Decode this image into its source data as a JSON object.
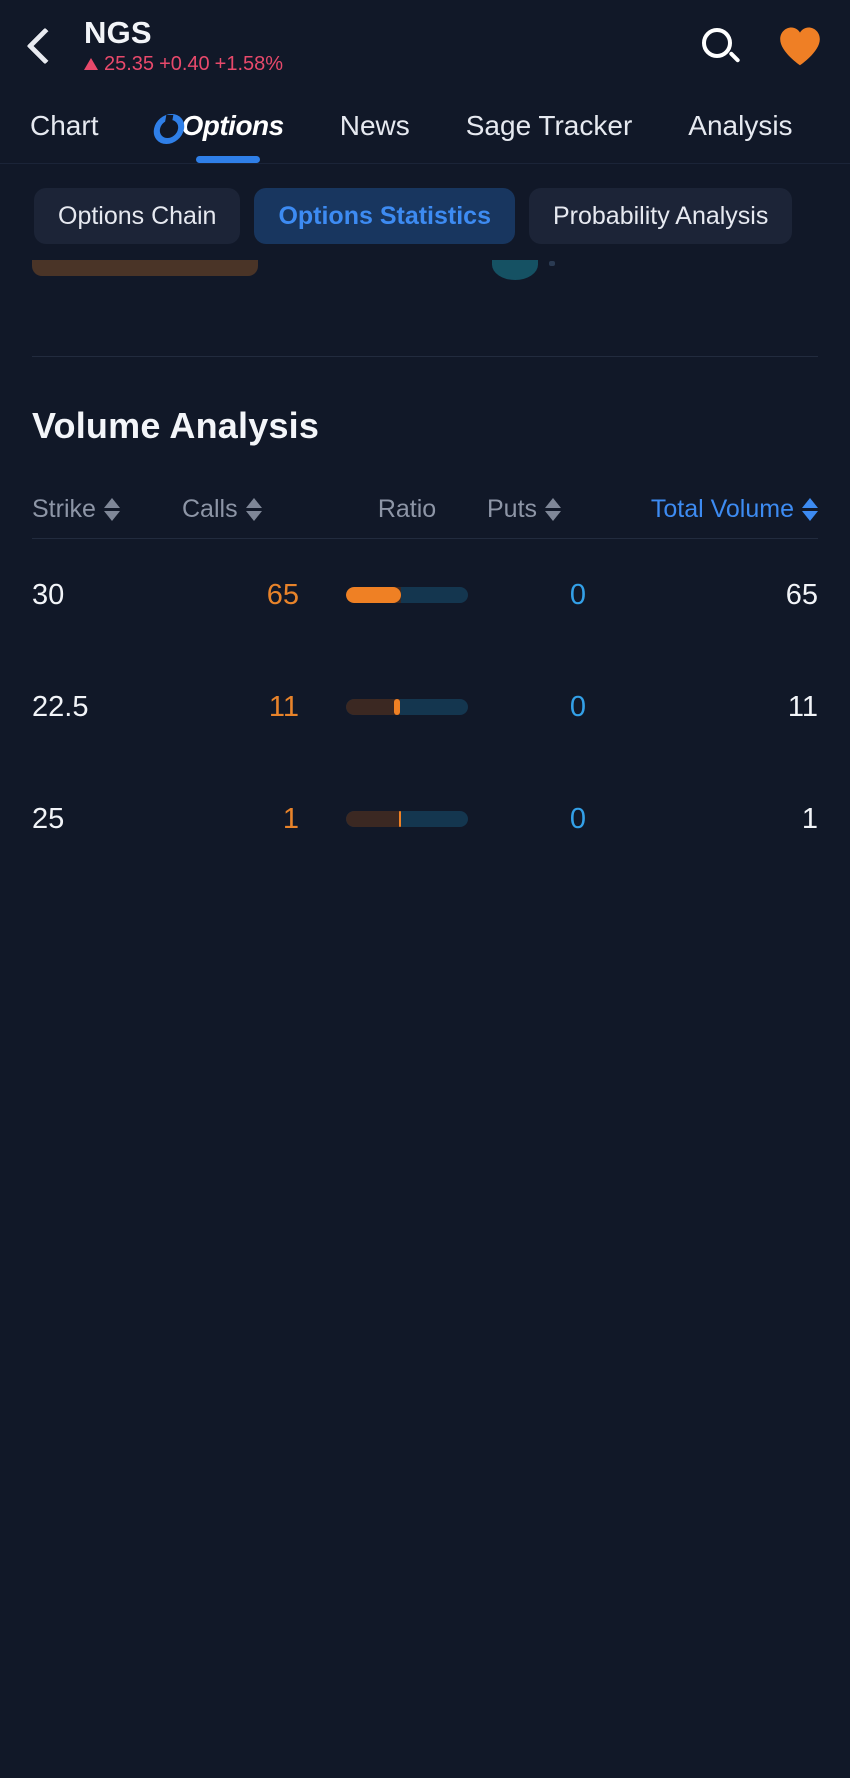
{
  "header": {
    "back_icon": "back-chevron-icon",
    "symbol": "NGS",
    "price": "25.35",
    "change": "+0.40",
    "change_percent": "+1.58%",
    "direction_icon": "up-triangle-icon",
    "change_color": "#e8496b",
    "search_icon": "search-icon",
    "favorite_icon": "heart-icon",
    "favorite_color": "#ef7f25"
  },
  "tabs": {
    "items": [
      {
        "label": "Chart",
        "active": false
      },
      {
        "label": "Options",
        "active": true
      },
      {
        "label": "News",
        "active": false
      },
      {
        "label": "Sage Tracker",
        "active": false
      },
      {
        "label": "Analysis",
        "active": false
      }
    ],
    "active_color": "#2f7fe8"
  },
  "segmented": {
    "items": [
      {
        "label": "Options Chain",
        "active": false
      },
      {
        "label": "Options Statistics",
        "active": true
      },
      {
        "label": "Probability Analysis",
        "active": false
      }
    ],
    "active_bg": "#18365f",
    "active_color": "#3d8bf2"
  },
  "volume_analysis": {
    "title": "Volume Analysis",
    "columns": [
      {
        "key": "strike",
        "label": "Strike",
        "sortable": true,
        "sorted": false
      },
      {
        "key": "calls",
        "label": "Calls",
        "sortable": true,
        "sorted": false
      },
      {
        "key": "ratio",
        "label": "Ratio",
        "sortable": false,
        "sorted": false
      },
      {
        "key": "puts",
        "label": "Puts",
        "sortable": true,
        "sorted": false
      },
      {
        "key": "total",
        "label": "Total Volume",
        "sortable": true,
        "sorted": true
      }
    ],
    "rows": [
      {
        "strike": "30",
        "calls": "65",
        "puts": "0",
        "total": "65",
        "call_share_pct": 45
      },
      {
        "strike": "22.5",
        "calls": "11",
        "puts": "0",
        "total": "11",
        "call_share_pct": 44
      },
      {
        "strike": "25",
        "calls": "1",
        "puts": "0",
        "total": "1",
        "call_share_pct": 45
      }
    ],
    "calls_color": "#e8832a",
    "puts_color": "#33a0e8"
  },
  "chart_data": {
    "type": "bar",
    "title": "Volume Analysis",
    "categories": [
      "30",
      "22.5",
      "25"
    ],
    "series": [
      {
        "name": "Calls",
        "values": [
          65,
          11,
          1
        ]
      },
      {
        "name": "Puts",
        "values": [
          0,
          0,
          0
        ]
      },
      {
        "name": "Total Volume",
        "values": [
          65,
          11,
          1
        ]
      }
    ],
    "xlabel": "Strike",
    "ylabel": "Volume",
    "legend": [
      "Calls",
      "Puts",
      "Total Volume"
    ]
  }
}
